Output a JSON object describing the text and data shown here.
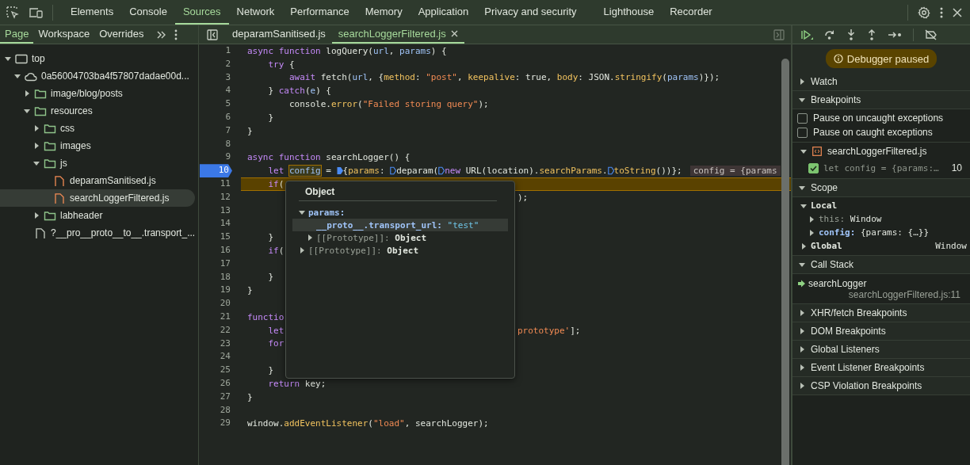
{
  "main_tabs": [
    {
      "label": "Elements",
      "selected": false
    },
    {
      "label": "Console",
      "selected": false
    },
    {
      "label": "Sources",
      "selected": true
    },
    {
      "label": "Network",
      "selected": false
    },
    {
      "label": "Performance",
      "selected": false
    },
    {
      "label": "Memory",
      "selected": false
    },
    {
      "label": "Application",
      "selected": false
    },
    {
      "label": "Privacy and security",
      "selected": false
    },
    {
      "label": "Lighthouse",
      "selected": false
    },
    {
      "label": "Recorder",
      "selected": false
    }
  ],
  "navigator": {
    "tabs": [
      {
        "label": "Page",
        "selected": true
      },
      {
        "label": "Workspace",
        "selected": false
      },
      {
        "label": "Overrides",
        "selected": false
      }
    ],
    "tree": [
      {
        "label": "top",
        "kind": "frame",
        "expanded": true,
        "selected": false,
        "children": [
          {
            "label": "0a56004703ba4f57807dadae00d...",
            "kind": "domain",
            "expanded": true,
            "selected": false,
            "children": [
              {
                "label": "image/blog/posts",
                "kind": "folder",
                "expanded": false,
                "selected": false
              },
              {
                "label": "resources",
                "kind": "folder",
                "expanded": true,
                "selected": false,
                "children": [
                  {
                    "label": "css",
                    "kind": "folder",
                    "expanded": false,
                    "selected": false
                  },
                  {
                    "label": "images",
                    "kind": "folder",
                    "expanded": false,
                    "selected": false
                  },
                  {
                    "label": "js",
                    "kind": "folder",
                    "expanded": true,
                    "selected": false,
                    "children": [
                      {
                        "label": "deparamSanitised.js",
                        "kind": "script",
                        "selected": false
                      },
                      {
                        "label": "searchLoggerFiltered.js",
                        "kind": "script",
                        "selected": true
                      }
                    ]
                  },
                  {
                    "label": "labheader",
                    "kind": "folder",
                    "expanded": false,
                    "selected": false
                  }
                ]
              },
              {
                "label": "?__pro__proto__to__.transport_...",
                "kind": "document",
                "selected": false
              }
            ]
          }
        ]
      }
    ]
  },
  "editor": {
    "tabs": [
      {
        "label": "deparamSanitised.js",
        "selected": false
      },
      {
        "label": "searchLoggerFiltered.js",
        "selected": true
      }
    ],
    "lines": [
      {
        "number": "1",
        "breakpoint": false,
        "paused": false,
        "tokens": [
          {
            "kind": "kw",
            "text": "async function "
          },
          {
            "kind": "def",
            "text": "logQuery"
          },
          {
            "kind": "p",
            "text": "("
          },
          {
            "kind": "var",
            "text": "url"
          },
          {
            "kind": "p",
            "text": ", "
          },
          {
            "kind": "var",
            "text": "params"
          },
          {
            "kind": "p",
            "text": ") {"
          }
        ]
      },
      {
        "number": "2",
        "breakpoint": false,
        "paused": false,
        "tokens": [
          {
            "kind": "kw",
            "text": "    try"
          },
          {
            "kind": "p",
            "text": " {"
          }
        ]
      },
      {
        "number": "3",
        "breakpoint": false,
        "paused": false,
        "tokens": [
          {
            "kind": "kw",
            "text": "        await"
          },
          {
            "kind": "p",
            "text": " fetch("
          },
          {
            "kind": "var",
            "text": "url"
          },
          {
            "kind": "p",
            "text": ", {"
          },
          {
            "kind": "prop",
            "text": "method"
          },
          {
            "kind": "p",
            "text": ": "
          },
          {
            "kind": "str",
            "text": "\"post\""
          },
          {
            "kind": "p",
            "text": ", "
          },
          {
            "kind": "prop",
            "text": "keepalive"
          },
          {
            "kind": "p",
            "text": ": true, "
          },
          {
            "kind": "prop",
            "text": "body"
          },
          {
            "kind": "p",
            "text": ": JSON."
          },
          {
            "kind": "prop",
            "text": "stringify"
          },
          {
            "kind": "p",
            "text": "("
          },
          {
            "kind": "var",
            "text": "params"
          },
          {
            "kind": "p",
            "text": ")});"
          }
        ]
      },
      {
        "number": "4",
        "breakpoint": false,
        "paused": false,
        "tokens": [
          {
            "kind": "p",
            "text": "    } "
          },
          {
            "kind": "kw",
            "text": "catch"
          },
          {
            "kind": "p",
            "text": "("
          },
          {
            "kind": "var",
            "text": "e"
          },
          {
            "kind": "p",
            "text": ") {"
          }
        ]
      },
      {
        "number": "5",
        "breakpoint": false,
        "paused": false,
        "tokens": [
          {
            "kind": "p",
            "text": "        console."
          },
          {
            "kind": "prop",
            "text": "error"
          },
          {
            "kind": "p",
            "text": "("
          },
          {
            "kind": "str",
            "text": "\"Failed storing query\""
          },
          {
            "kind": "p",
            "text": ");"
          }
        ]
      },
      {
        "number": "6",
        "breakpoint": false,
        "paused": false,
        "tokens": [
          {
            "kind": "p",
            "text": "    }"
          }
        ]
      },
      {
        "number": "7",
        "breakpoint": false,
        "paused": false,
        "tokens": [
          {
            "kind": "p",
            "text": "}"
          }
        ]
      },
      {
        "number": "8",
        "breakpoint": false,
        "paused": false
      },
      {
        "number": "9",
        "breakpoint": false,
        "paused": false,
        "tokens": [
          {
            "kind": "kw",
            "text": "async function "
          },
          {
            "kind": "def",
            "text": "searchLogger"
          },
          {
            "kind": "p",
            "text": "() {"
          }
        ]
      },
      {
        "number": "10",
        "breakpoint": true,
        "paused": false,
        "tokens": [
          {
            "kind": "kw",
            "text": "    let "
          },
          {
            "kind": "hover",
            "text": "config"
          },
          {
            "kind": "p",
            "text": " = "
          },
          {
            "kind": "mark",
            "active": true
          },
          {
            "kind": "p",
            "text": "{"
          },
          {
            "kind": "prop",
            "text": "params"
          },
          {
            "kind": "p",
            "text": ": "
          },
          {
            "kind": "mark",
            "active": false
          },
          {
            "kind": "p",
            "text": "deparam("
          },
          {
            "kind": "mark",
            "active": false
          },
          {
            "kind": "kw",
            "text": "new"
          },
          {
            "kind": "p",
            "text": " URL(location)."
          },
          {
            "kind": "prop",
            "text": "searchParams"
          },
          {
            "kind": "p",
            "text": "."
          },
          {
            "kind": "mark",
            "active": false
          },
          {
            "kind": "prop",
            "text": "toString"
          },
          {
            "kind": "p",
            "text": "())};"
          }
        ],
        "inline_value": "config = {params"
      },
      {
        "number": "11",
        "breakpoint": false,
        "paused": true,
        "tokens": [
          {
            "kind": "kw",
            "text": "    if"
          },
          {
            "kind": "p",
            "text": "("
          }
        ]
      },
      {
        "number": "12",
        "breakpoint": false,
        "paused": false,
        "tail": [
          {
            "kind": "p",
            "text": ");"
          }
        ]
      },
      {
        "number": "13",
        "breakpoint": false,
        "paused": false
      },
      {
        "number": "14",
        "breakpoint": false,
        "paused": false
      },
      {
        "number": "15",
        "breakpoint": false,
        "paused": false,
        "tokens": [
          {
            "kind": "p",
            "text": "    }"
          }
        ]
      },
      {
        "number": "16",
        "breakpoint": false,
        "paused": false,
        "tokens": [
          {
            "kind": "kw",
            "text": "    if"
          },
          {
            "kind": "p",
            "text": "("
          }
        ]
      },
      {
        "number": "17",
        "breakpoint": false,
        "paused": false
      },
      {
        "number": "18",
        "breakpoint": false,
        "paused": false,
        "tokens": [
          {
            "kind": "p",
            "text": "    }"
          }
        ]
      },
      {
        "number": "19",
        "breakpoint": false,
        "paused": false,
        "tokens": [
          {
            "kind": "p",
            "text": "}"
          }
        ]
      },
      {
        "number": "20",
        "breakpoint": false,
        "paused": false
      },
      {
        "number": "21",
        "breakpoint": false,
        "paused": false,
        "tokens": [
          {
            "kind": "kw",
            "text": "functio"
          }
        ]
      },
      {
        "number": "22",
        "breakpoint": false,
        "paused": false,
        "tokens": [
          {
            "kind": "kw",
            "text": "    let"
          }
        ],
        "tail": [
          {
            "kind": "str",
            "text": "prototype'"
          },
          {
            "kind": "p",
            "text": "];"
          }
        ]
      },
      {
        "number": "23",
        "breakpoint": false,
        "paused": false,
        "tokens": [
          {
            "kind": "kw",
            "text": "    for"
          }
        ]
      },
      {
        "number": "24",
        "breakpoint": false,
        "paused": false
      },
      {
        "number": "25",
        "breakpoint": false,
        "paused": false,
        "tokens": [
          {
            "kind": "p",
            "text": "    }"
          }
        ]
      },
      {
        "number": "26",
        "breakpoint": false,
        "paused": false,
        "tokens": [
          {
            "kind": "kw",
            "text": "    return"
          },
          {
            "kind": "p",
            "text": " key;"
          }
        ]
      },
      {
        "number": "27",
        "breakpoint": false,
        "paused": false,
        "tokens": [
          {
            "kind": "p",
            "text": "}"
          }
        ]
      },
      {
        "number": "28",
        "breakpoint": false,
        "paused": false
      },
      {
        "number": "29",
        "breakpoint": false,
        "paused": false,
        "tokens": [
          {
            "kind": "p",
            "text": "window."
          },
          {
            "kind": "prop",
            "text": "addEventListener"
          },
          {
            "kind": "p",
            "text": "("
          },
          {
            "kind": "str",
            "text": "\"load\""
          },
          {
            "kind": "p",
            "text": ", searchLogger);"
          }
        ]
      }
    ],
    "popover": {
      "title": "Object",
      "rows": [
        {
          "key": "params:",
          "kind": "object",
          "expanded": true,
          "selected": false,
          "children": [
            {
              "key": "__proto__.transport_url:",
              "value": "\"test\"",
              "kind": "string",
              "selected": true
            },
            {
              "key": "[[Prototype]]:",
              "value": "Object",
              "kind": "internal",
              "expanded": false,
              "selected": false
            }
          ]
        },
        {
          "key": "[[Prototype]]:",
          "value": "Object",
          "kind": "internal",
          "expanded": false,
          "selected": false
        }
      ]
    }
  },
  "debugger": {
    "status": "Debugger paused",
    "sections": [
      {
        "title": "Watch",
        "expanded": false
      },
      {
        "title": "Breakpoints",
        "expanded": true,
        "kind": "breakpoints",
        "options": [
          {
            "label": "Pause on uncaught exceptions",
            "checked": false
          },
          {
            "label": "Pause on caught exceptions",
            "checked": false
          }
        ],
        "files": [
          {
            "name": "searchLoggerFiltered.js",
            "expanded": true,
            "breakpoints": [
              {
                "code": "let config = {params:…",
                "line": "10",
                "checked": true
              }
            ]
          }
        ]
      },
      {
        "title": "Scope",
        "expanded": true,
        "kind": "scope",
        "scopes": [
          {
            "name": "Local",
            "expanded": true,
            "variables": [
              {
                "name": "this:",
                "value": "Window",
                "kind": "receiver",
                "expanded": false
              },
              {
                "name": "config:",
                "value": "{params: {…}}",
                "kind": "variable",
                "expanded": false
              }
            ]
          },
          {
            "name": "Global",
            "expanded": false,
            "value": "Window"
          }
        ]
      },
      {
        "title": "Call Stack",
        "expanded": true,
        "kind": "callstack",
        "frames": [
          {
            "function": "searchLogger",
            "location": "searchLoggerFiltered.js:11",
            "current": true
          }
        ]
      },
      {
        "title": "XHR/fetch Breakpoints",
        "expanded": false
      },
      {
        "title": "DOM Breakpoints",
        "expanded": false
      },
      {
        "title": "Global Listeners",
        "expanded": false
      },
      {
        "title": "Event Listener Breakpoints",
        "expanded": false
      },
      {
        "title": "CSP Violation Breakpoints",
        "expanded": false
      }
    ]
  }
}
